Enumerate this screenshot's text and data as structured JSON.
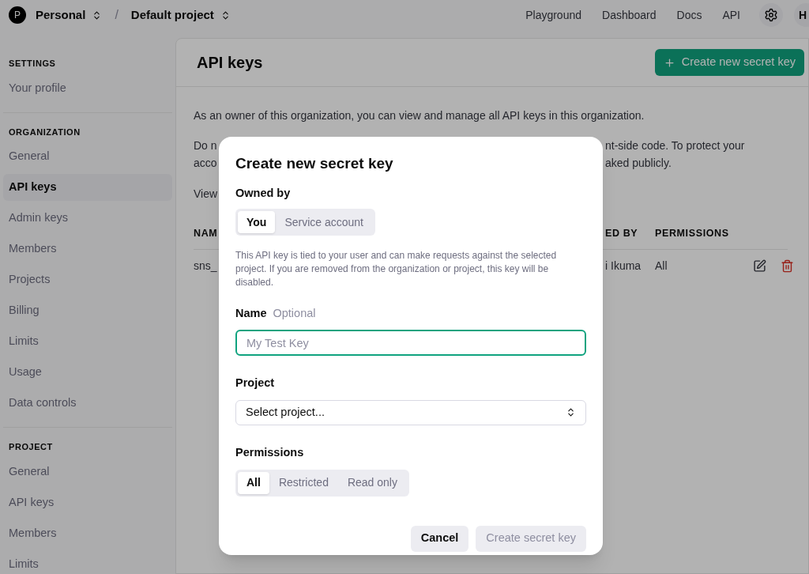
{
  "top_bar": {
    "avatar_letter": "P",
    "org": "Personal",
    "separator": "/",
    "project": "Default project",
    "nav": [
      "Playground",
      "Dashboard",
      "Docs",
      "API"
    ],
    "user_initial": "H"
  },
  "sidebar": {
    "sections": [
      {
        "heading": "SETTINGS",
        "items": [
          {
            "label": "Your profile",
            "selected": false
          }
        ]
      },
      {
        "heading": "ORGANIZATION",
        "items": [
          {
            "label": "General",
            "selected": false
          },
          {
            "label": "API keys",
            "selected": true
          },
          {
            "label": "Admin keys",
            "selected": false
          },
          {
            "label": "Members",
            "selected": false
          },
          {
            "label": "Projects",
            "selected": false
          },
          {
            "label": "Billing",
            "selected": false
          },
          {
            "label": "Limits",
            "selected": false
          },
          {
            "label": "Usage",
            "selected": false
          },
          {
            "label": "Data controls",
            "selected": false
          }
        ]
      },
      {
        "heading": "PROJECT",
        "items": [
          {
            "label": "General",
            "selected": false
          },
          {
            "label": "API keys",
            "selected": false
          },
          {
            "label": "Members",
            "selected": false
          },
          {
            "label": "Limits",
            "selected": false
          }
        ]
      }
    ]
  },
  "main": {
    "title": "API keys",
    "create_button": "Create new secret key",
    "intro": "As an owner of this organization, you can view and manage all API keys in this organization.",
    "paragraph_lines": [
      {
        "left": "Do n",
        "right": "nt-side code. To protect your"
      },
      {
        "left": "acco",
        "right": "aked publicly."
      }
    ],
    "view_line": "View",
    "table": {
      "columns": [
        "NAM",
        "ED BY",
        "PERMISSIONS"
      ],
      "rows": [
        {
          "cells": [
            "sns_",
            "i Ikuma",
            "All"
          ]
        }
      ]
    }
  },
  "modal": {
    "title": "Create new secret key",
    "owned_by_label": "Owned by",
    "owner_options": [
      {
        "label": "You",
        "selected": true
      },
      {
        "label": "Service account",
        "selected": false
      }
    ],
    "owner_note": "This API key is tied to your user and can make requests against the selected project. If you are removed from the organization or project, this key will be disabled.",
    "name_label": "Name",
    "name_hint": "Optional",
    "name_field": {
      "placeholder": "My Test Key",
      "focused": true
    },
    "project_label": "Project",
    "project_select": "Select project...",
    "permissions_label": "Permissions",
    "permission_options": [
      {
        "label": "All",
        "selected": true
      },
      {
        "label": "Restricted",
        "selected": false
      },
      {
        "label": "Read only",
        "selected": false
      }
    ],
    "buttons": [
      {
        "label": "Cancel",
        "disabled": false
      },
      {
        "label": "Create secret key",
        "disabled": true
      }
    ]
  }
}
